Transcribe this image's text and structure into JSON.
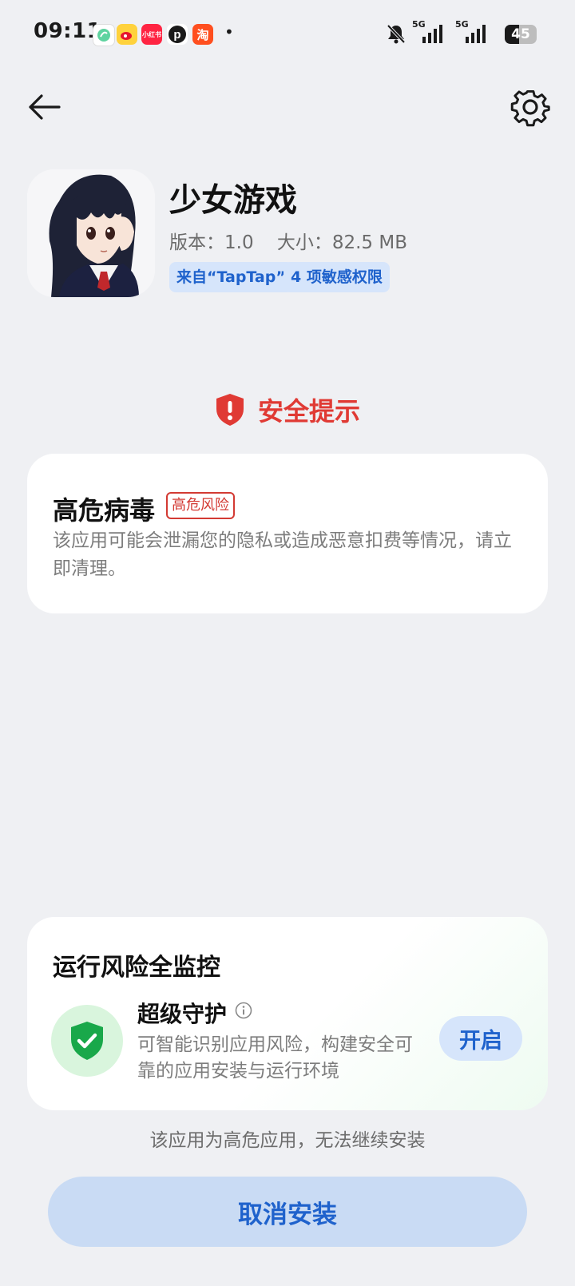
{
  "status_bar": {
    "time": "09:11",
    "notification_icons": [
      "mint-app-icon",
      "weibo-icon",
      "xiaohongshu-icon",
      "pinterest-icon",
      "taobao-icon"
    ],
    "xiaohongshu_label": "小红书",
    "taobao_label": "淘",
    "more_dot": "•",
    "network_1": "5G",
    "network_2": "5G",
    "battery": "45"
  },
  "app": {
    "name": "少女游戏",
    "meta": "版本：1.0    大小：82.5 MB",
    "source_tag": "来自“TapTap”",
    "permissions_tag": "4 项敏感权限"
  },
  "security_notice": {
    "title": "安全提示",
    "color": "#e03a34"
  },
  "virus_card": {
    "title": "高危病毒",
    "badge": "高危风险",
    "description": "该应用可能会泄漏您的隐私或造成恶意扣费等情况，请立即清理。"
  },
  "monitor_card": {
    "title": "运行风险全监控",
    "feature_title": "超级守护",
    "feature_description": "可智能识别应用风险，构建安全可靠的应用安装与运行环境",
    "enable_label": "开启"
  },
  "footer": {
    "warning": "该应用为高危应用，无法继续安装",
    "cancel_label": "取消安装"
  },
  "colors": {
    "accent": "#1f62cc",
    "danger": "#d33a33",
    "background": "#eff0f3"
  }
}
